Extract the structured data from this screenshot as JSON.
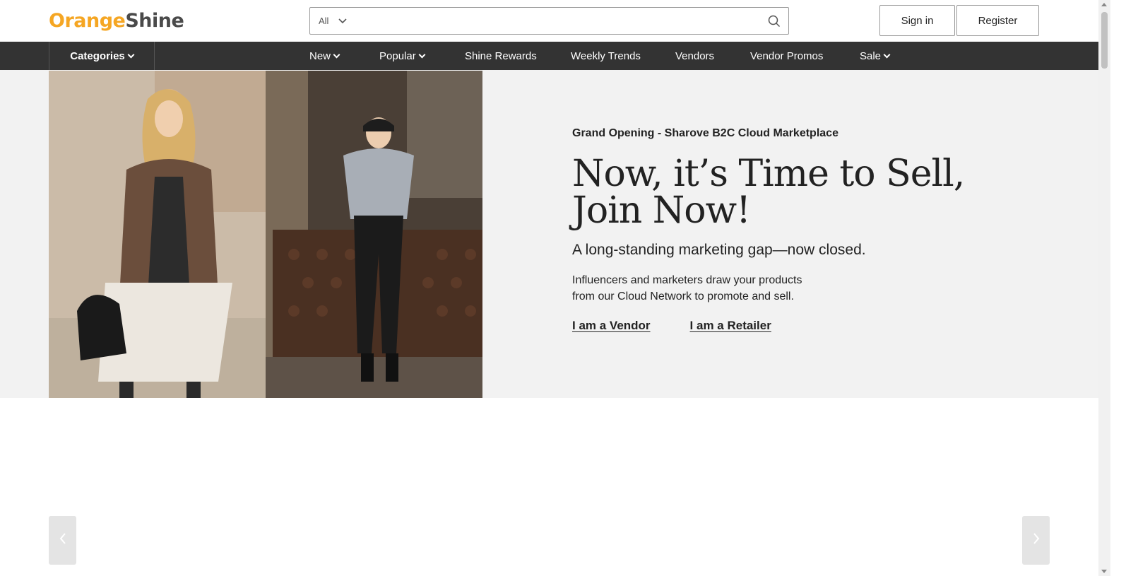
{
  "header": {
    "logo_part1": "Orange",
    "logo_part2": "Shine",
    "search": {
      "category": "All",
      "placeholder": ""
    },
    "signin_label": "Sign in",
    "register_label": "Register"
  },
  "nav": {
    "categories_label": "Categories",
    "items": [
      {
        "label": "New"
      },
      {
        "label": "Popular"
      },
      {
        "label": "Shine Rewards"
      },
      {
        "label": "Weekly Trends"
      },
      {
        "label": "Vendors"
      },
      {
        "label": "Vendor Promos"
      },
      {
        "label": "Sale"
      }
    ]
  },
  "hero": {
    "eyebrow": "Grand Opening - Sharove B2C Cloud Marketplace",
    "headline_line1": "Now, it’s Time to Sell,",
    "headline_line2": "Join Now!",
    "subhead": "A long-standing marketing gap—now closed.",
    "desc_line1": "Influencers and marketers draw your products",
    "desc_line2": "from our Cloud Network to promote and sell.",
    "link_vendor": "I am a Vendor",
    "link_retailer": "I am a Retailer"
  },
  "colors": {
    "brand_orange": "#f5a623",
    "nav_bg": "#333333",
    "hero_bg": "#f2f2f2"
  }
}
